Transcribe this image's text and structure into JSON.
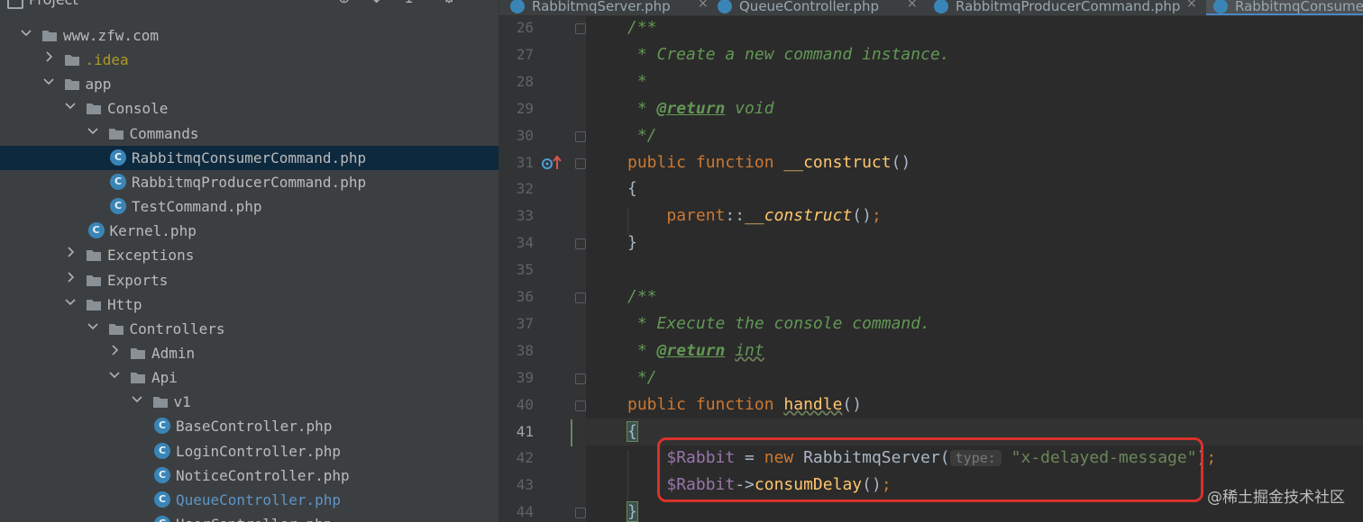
{
  "sidebar": {
    "title": "Project",
    "tree": [
      {
        "label": "www.zfw.com",
        "kind": "folder",
        "depth": 0,
        "expanded": true
      },
      {
        "label": ".idea",
        "kind": "folder",
        "depth": 1,
        "expanded": false,
        "style": "excluded"
      },
      {
        "label": "app",
        "kind": "folder",
        "depth": 1,
        "expanded": true
      },
      {
        "label": "Console",
        "kind": "folder",
        "depth": 2,
        "expanded": true
      },
      {
        "label": "Commands",
        "kind": "folder",
        "depth": 3,
        "expanded": true
      },
      {
        "label": "RabbitmqConsumerCommand.php",
        "kind": "class",
        "depth": 4,
        "selected": true
      },
      {
        "label": "RabbitmqProducerCommand.php",
        "kind": "class",
        "depth": 4
      },
      {
        "label": "TestCommand.php",
        "kind": "class",
        "depth": 4
      },
      {
        "label": "Kernel.php",
        "kind": "class",
        "depth": 3
      },
      {
        "label": "Exceptions",
        "kind": "folder",
        "depth": 2,
        "expanded": false
      },
      {
        "label": "Exports",
        "kind": "folder",
        "depth": 2,
        "expanded": false
      },
      {
        "label": "Http",
        "kind": "folder",
        "depth": 2,
        "expanded": true
      },
      {
        "label": "Controllers",
        "kind": "folder",
        "depth": 3,
        "expanded": true
      },
      {
        "label": "Admin",
        "kind": "folder",
        "depth": 4,
        "expanded": false
      },
      {
        "label": "Api",
        "kind": "folder",
        "depth": 4,
        "expanded": true
      },
      {
        "label": "v1",
        "kind": "folder",
        "depth": 5,
        "expanded": true
      },
      {
        "label": "BaseController.php",
        "kind": "class",
        "depth": 6
      },
      {
        "label": "LoginController.php",
        "kind": "class",
        "depth": 6
      },
      {
        "label": "NoticeController.php",
        "kind": "class",
        "depth": 6
      },
      {
        "label": "QueueController.php",
        "kind": "class",
        "depth": 6,
        "style": "modified"
      },
      {
        "label": "UserController.php",
        "kind": "class",
        "depth": 6
      }
    ]
  },
  "tabs": [
    {
      "label": "RabbitmqServer.php",
      "active": false,
      "close": "×"
    },
    {
      "label": "QueueController.php",
      "active": false,
      "close": "×"
    },
    {
      "label": "RabbitmqProducerCommand.php",
      "active": false,
      "close": "×"
    },
    {
      "label": "RabbitmqConsumerCommand.php",
      "active": true,
      "close": ""
    }
  ],
  "editor": {
    "current_line": "41",
    "lines": [
      {
        "n": "26",
        "tokens": [
          [
            "doc",
            "/**"
          ]
        ]
      },
      {
        "n": "27",
        "tokens": [
          [
            "doc",
            " * Create a new command instance."
          ]
        ]
      },
      {
        "n": "28",
        "tokens": [
          [
            "doc",
            " *"
          ]
        ]
      },
      {
        "n": "29",
        "tokens": [
          [
            "doc",
            " * "
          ],
          [
            "tag",
            "@return"
          ],
          [
            "doc",
            " void"
          ]
        ]
      },
      {
        "n": "30",
        "tokens": [
          [
            "doc",
            " */"
          ]
        ]
      },
      {
        "n": "31",
        "tokens": [
          [
            "kw",
            "public function "
          ],
          [
            "fn",
            "__construct"
          ],
          [
            "plain",
            "()"
          ]
        ]
      },
      {
        "n": "32",
        "tokens": [
          [
            "plain",
            "{"
          ]
        ]
      },
      {
        "n": "33",
        "tokens": [
          [
            "plain",
            "    "
          ],
          [
            "kw",
            "parent"
          ],
          [
            "plain",
            "::"
          ],
          [
            "fn-i",
            "__construct"
          ],
          [
            "plain",
            "()"
          ],
          [
            "kw",
            ";"
          ]
        ]
      },
      {
        "n": "34",
        "tokens": [
          [
            "plain",
            "}"
          ]
        ]
      },
      {
        "n": "35",
        "tokens": []
      },
      {
        "n": "36",
        "tokens": [
          [
            "doc",
            "/**"
          ]
        ]
      },
      {
        "n": "37",
        "tokens": [
          [
            "doc",
            " * Execute the console command."
          ]
        ]
      },
      {
        "n": "38",
        "tokens": [
          [
            "doc",
            " * "
          ],
          [
            "tag",
            "@return"
          ],
          [
            "doc",
            " "
          ],
          [
            "doc wavy",
            "int"
          ]
        ]
      },
      {
        "n": "39",
        "tokens": [
          [
            "doc",
            " */"
          ]
        ]
      },
      {
        "n": "40",
        "tokens": [
          [
            "kw",
            "public function "
          ],
          [
            "fn wavy",
            "handle"
          ],
          [
            "plain",
            "()"
          ]
        ]
      },
      {
        "n": "41",
        "tokens": [
          [
            "plain brace-match",
            "{"
          ]
        ]
      },
      {
        "n": "42",
        "tokens": [
          [
            "plain",
            "    "
          ],
          [
            "var",
            "$Rabbit"
          ],
          [
            "plain",
            " = "
          ],
          [
            "kw",
            "new "
          ],
          [
            "plain",
            "RabbitmqServer("
          ],
          [
            "hint",
            "type:"
          ],
          [
            "str",
            "\"x-delayed-message\""
          ],
          [
            "plain",
            ")"
          ],
          [
            "kw",
            ";"
          ]
        ]
      },
      {
        "n": "43",
        "tokens": [
          [
            "plain",
            "    "
          ],
          [
            "var",
            "$Rabbit"
          ],
          [
            "plain",
            "->"
          ],
          [
            "fn",
            "consumDelay"
          ],
          [
            "plain",
            "()"
          ],
          [
            "kw",
            ";"
          ]
        ]
      },
      {
        "n": "44",
        "tokens": [
          [
            "plain brace-match",
            "}"
          ]
        ]
      }
    ]
  },
  "watermark": "@稀土掘金技术社区",
  "colors": {
    "editor_bg": "#2b2b2b",
    "sidebar_bg": "#3c3f41",
    "selection": "#0d293e",
    "keyword": "#cc7832",
    "function": "#ffc66d",
    "doc_comment": "#629755",
    "string": "#6a8759",
    "variable": "#9876aa",
    "highlight_box": "#d9322a"
  },
  "icons": {
    "folder": "folder-icon",
    "class_file": "php-class-icon",
    "gutter_31": "override-method-icon"
  }
}
